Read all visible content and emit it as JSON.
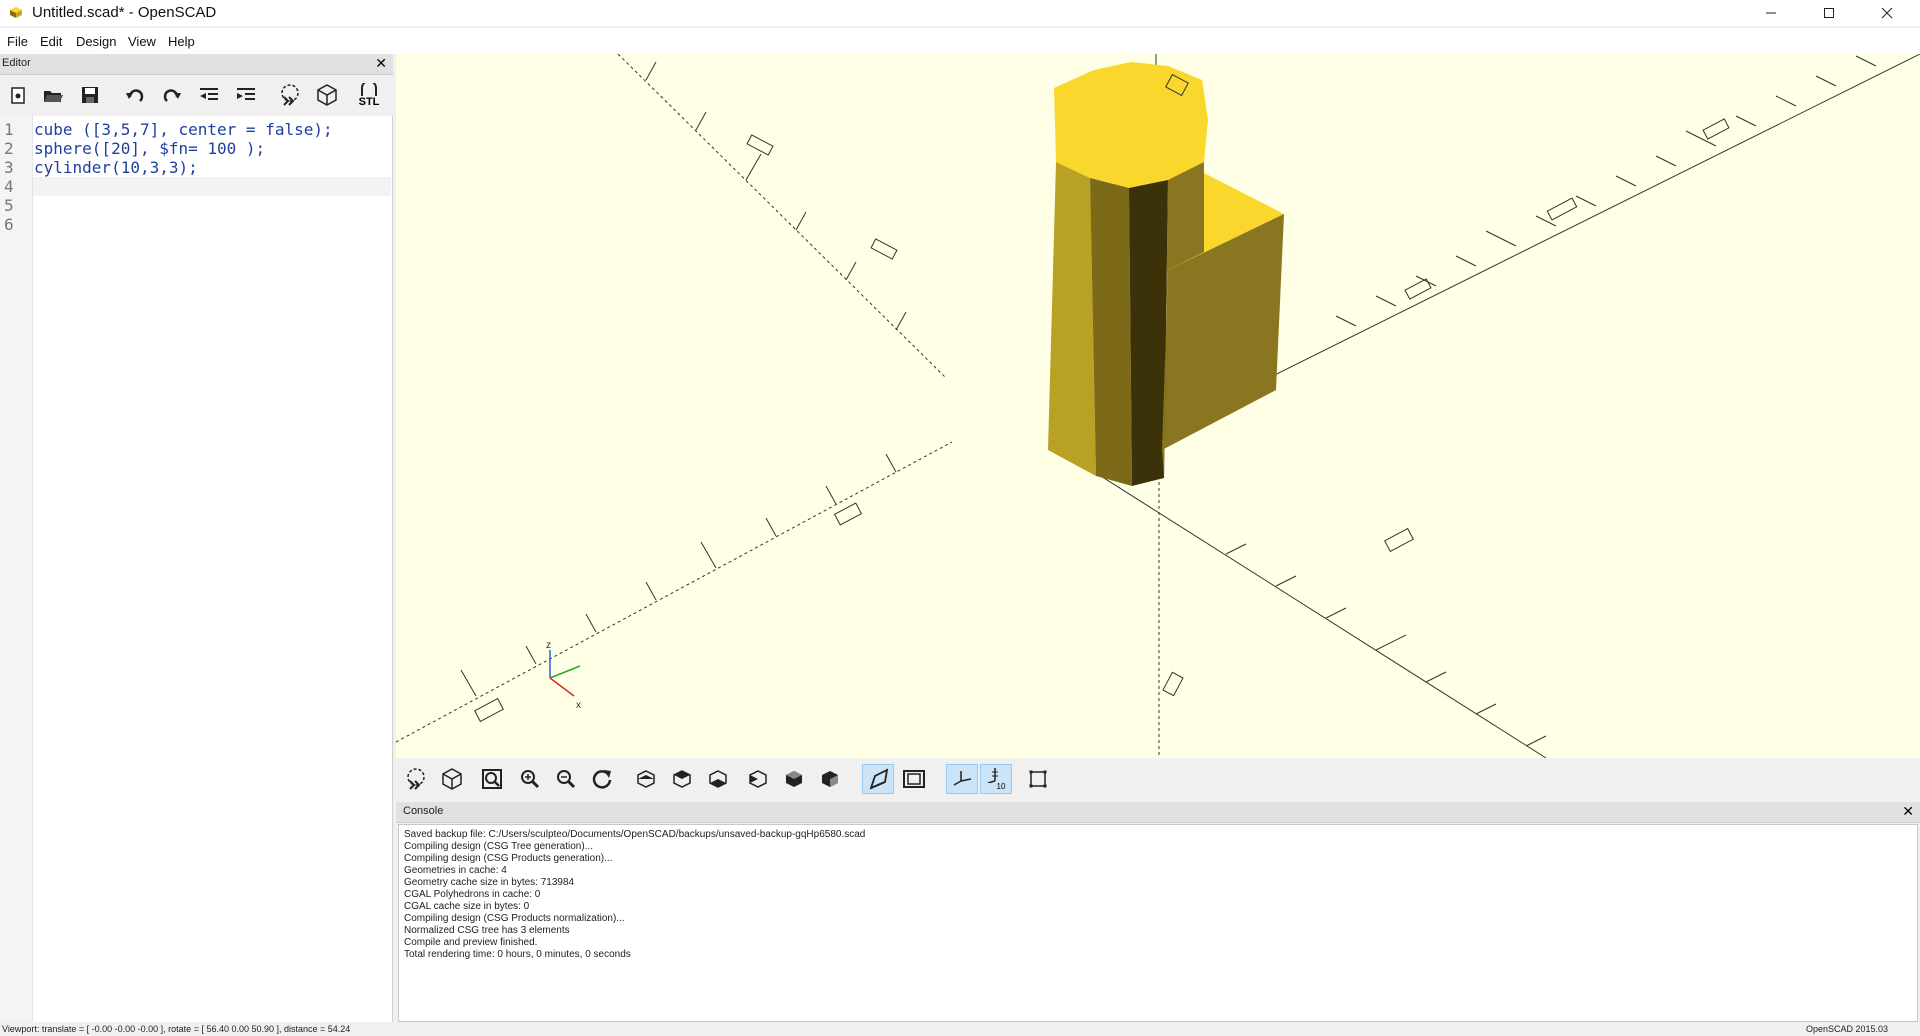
{
  "window": {
    "title": "Untitled.scad* - OpenSCAD"
  },
  "menu": [
    "File",
    "Edit",
    "Design",
    "View",
    "Help"
  ],
  "editor": {
    "title": "Editor",
    "close_glyph": "✕",
    "toolbar": [
      {
        "name": "new-file-icon"
      },
      {
        "name": "open-file-icon"
      },
      {
        "name": "save-icon"
      },
      {
        "name": "undo-icon"
      },
      {
        "name": "redo-icon"
      },
      {
        "name": "unindent-icon"
      },
      {
        "name": "indent-icon"
      },
      {
        "name": "preview-icon"
      },
      {
        "name": "render-icon"
      },
      {
        "name": "export-stl-icon",
        "label": "STL"
      }
    ],
    "lines": [
      "1",
      "2",
      "3",
      "4",
      "5",
      "6"
    ],
    "code": [
      "cube ([3,5,7], center = false);",
      "sphere([20], $fn= 100 );",
      "cylinder(10,3,3);"
    ]
  },
  "viewport": {
    "axis_label_z": "z",
    "axis_label_x": "x"
  },
  "view_toolbar": [
    {
      "name": "preview-icon"
    },
    {
      "name": "render-icon"
    },
    {
      "name": "view-all-icon"
    },
    {
      "name": "zoom-in-icon"
    },
    {
      "name": "zoom-out-icon"
    },
    {
      "name": "reset-view-icon"
    },
    {
      "name": "view-right-icon"
    },
    {
      "name": "view-top-icon"
    },
    {
      "name": "view-bottom-icon"
    },
    {
      "name": "view-left-icon"
    },
    {
      "name": "view-front-icon"
    },
    {
      "name": "view-back-icon"
    },
    {
      "name": "perspective-icon",
      "active": true
    },
    {
      "name": "orthogonal-icon"
    },
    {
      "name": "show-axes-icon",
      "active": true
    },
    {
      "name": "show-scale-markers-icon",
      "active": true,
      "label": "10"
    },
    {
      "name": "show-edges-icon"
    }
  ],
  "console": {
    "title": "Console",
    "close_glyph": "✕",
    "lines": [
      "Saved backup file: C:/Users/sculpteo/Documents/OpenSCAD/backups/unsaved-backup-gqHp6580.scad",
      "Compiling design (CSG Tree generation)...",
      "Compiling design (CSG Products generation)...",
      "Geometries in cache: 4",
      "Geometry cache size in bytes: 713984",
      "CGAL Polyhedrons in cache: 0",
      "CGAL cache size in bytes: 0",
      "Compiling design (CSG Products normalization)...",
      "Normalized CSG tree has 3 elements",
      "Compile and preview finished.",
      "Total rendering time: 0 hours, 0 minutes, 0 seconds"
    ]
  },
  "status": {
    "viewport": "Viewport: translate = [ -0.00 -0.00 -0.00 ], rotate = [ 56.40 0.00 50.90 ], distance = 54.24",
    "version": "OpenSCAD 2015.03"
  },
  "colors": {
    "viewport_bg": "#ffffe5",
    "model_top": "#f9d72c",
    "model_side": "#8a7520",
    "accent": "#cce4f7"
  }
}
